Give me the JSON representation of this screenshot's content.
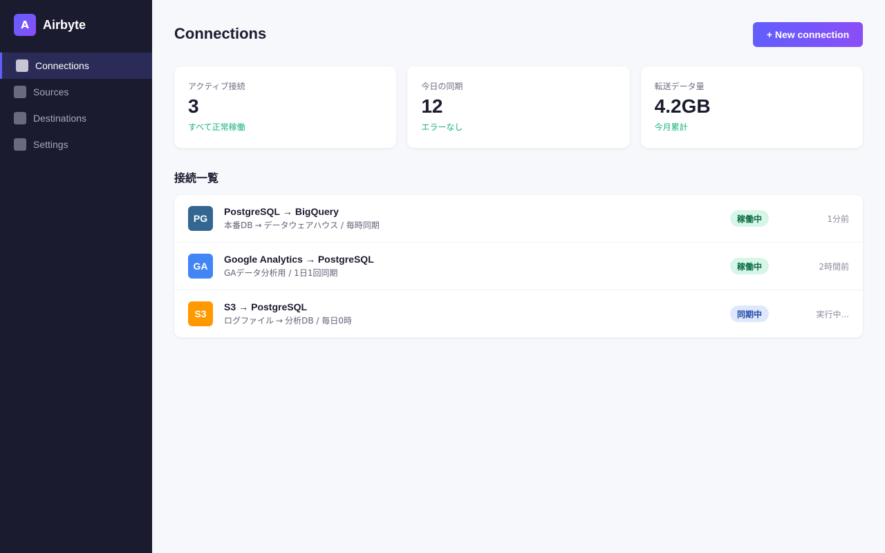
{
  "brand": {
    "logo_letter": "A",
    "name": "Airbyte"
  },
  "nav": {
    "items": [
      {
        "label": "Connections",
        "icon": "connections-icon"
      },
      {
        "label": "Sources",
        "icon": "sources-icon"
      },
      {
        "label": "Destinations",
        "icon": "destinations-icon"
      },
      {
        "label": "Settings",
        "icon": "settings-icon"
      }
    ]
  },
  "header": {
    "title": "Connections",
    "new_button": "+ New connection"
  },
  "stats": [
    {
      "label": "アクティブ接続",
      "value": "3",
      "note": "すべて正常稼働"
    },
    {
      "label": "今日の同期",
      "value": "12",
      "note": "エラーなし"
    },
    {
      "label": "転送データ量",
      "value": "4.2GB",
      "note": "今月累計"
    }
  ],
  "section_title": "接続一覧",
  "arrow": "→",
  "connections": [
    {
      "badge": "PG",
      "badge_color": "#336791",
      "source": "PostgreSQL",
      "destination": "BigQuery",
      "sub_from": "本番DB",
      "sub_to": "データウェアハウス / 毎時同期",
      "status": "稼働中",
      "status_type": "ok",
      "time": "1分前"
    },
    {
      "badge": "GA",
      "badge_color": "#4285f4",
      "source": "Google Analytics",
      "destination": "PostgreSQL",
      "sub_from": "",
      "sub_to": "GAデータ分析用 / 1日1回同期",
      "status": "稼働中",
      "status_type": "ok",
      "time": "2時間前"
    },
    {
      "badge": "S3",
      "badge_color": "#ff9900",
      "source": "S3",
      "destination": "PostgreSQL",
      "sub_from": "ログファイル",
      "sub_to": "分析DB / 毎日0時",
      "status": "同期中",
      "status_type": "sync",
      "time": "実行中..."
    }
  ],
  "colors": {
    "accent": "#615efc",
    "accent_end": "#8b4ef7",
    "sidebar_bg": "#1b1b2f",
    "ok_text": "#16b37a"
  }
}
